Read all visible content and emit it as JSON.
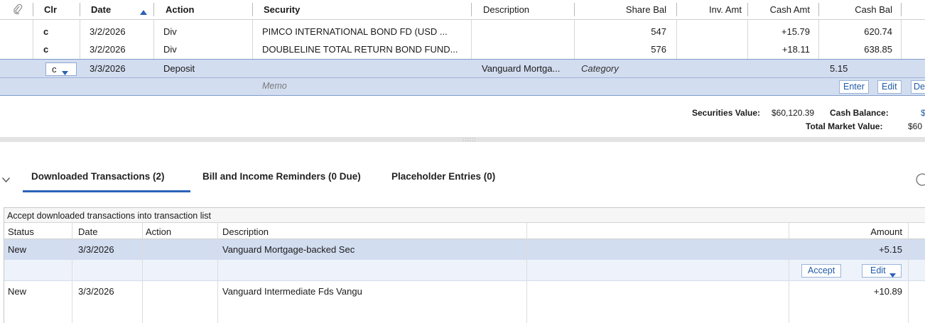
{
  "register": {
    "columns": {
      "attach_icon": "paperclip-icon",
      "clr": "Clr",
      "date": "Date",
      "action": "Action",
      "security": "Security",
      "description": "Description",
      "share_bal": "Share Bal",
      "inv_amt": "Inv. Amt",
      "cash_amt": "Cash Amt",
      "cash_bal": "Cash Bal"
    },
    "rows": [
      {
        "clr": "c",
        "date": "3/2/2026",
        "action": "Div",
        "security": "PIMCO INTERNATIONAL BOND FD (USD ...",
        "description": "",
        "share_bal": "547",
        "inv_amt": "",
        "cash_amt": "+15.79",
        "cash_bal": "620.74"
      },
      {
        "clr": "c",
        "date": "3/2/2026",
        "action": "Div",
        "security": "DOUBLELINE TOTAL RETURN BOND FUND...",
        "description": "",
        "share_bal": "576",
        "inv_amt": "",
        "cash_amt": "+18.11",
        "cash_bal": "638.85"
      }
    ],
    "edit_row": {
      "clr": "c",
      "date": "3/3/2026",
      "action": "Deposit",
      "description": "Vanguard Mortga...",
      "category_placeholder": "Category",
      "amount": "5.15",
      "memo_placeholder": "Memo",
      "buttons": {
        "enter": "Enter",
        "edit": "Edit",
        "delete_partial": "De"
      }
    }
  },
  "summary": {
    "securities_value_label": "Securities Value:",
    "securities_value": "$60,120.39",
    "cash_balance_label": "Cash Balance:",
    "cash_balance_partial": "$",
    "total_market_value_label": "Total Market Value:",
    "total_market_value_partial": "$60"
  },
  "tabs": [
    {
      "label": "Downloaded Transactions (2)",
      "active": true
    },
    {
      "label": "Bill and Income Reminders (0 Due)",
      "active": false
    },
    {
      "label": "Placeholder Entries (0)",
      "active": false
    }
  ],
  "downloaded": {
    "caption": "Accept downloaded transactions into transaction list",
    "columns": {
      "status": "Status",
      "date": "Date",
      "action": "Action",
      "description": "Description",
      "amount": "Amount"
    },
    "rows": [
      {
        "status": "New",
        "date": "3/3/2026",
        "action": "",
        "description": "Vanguard Mortgage-backed Sec",
        "amount": "+5.15"
      },
      {
        "status": "New",
        "date": "3/3/2026",
        "action": "",
        "description": "Vanguard Intermediate Fds Vangu",
        "amount": "+10.89"
      }
    ],
    "buttons": {
      "accept": "Accept",
      "edit": "Edit"
    }
  },
  "colors": {
    "accent": "#1f5aa6",
    "selected_row": "#d3ddf0",
    "tab_underline": "#2a62b8"
  }
}
